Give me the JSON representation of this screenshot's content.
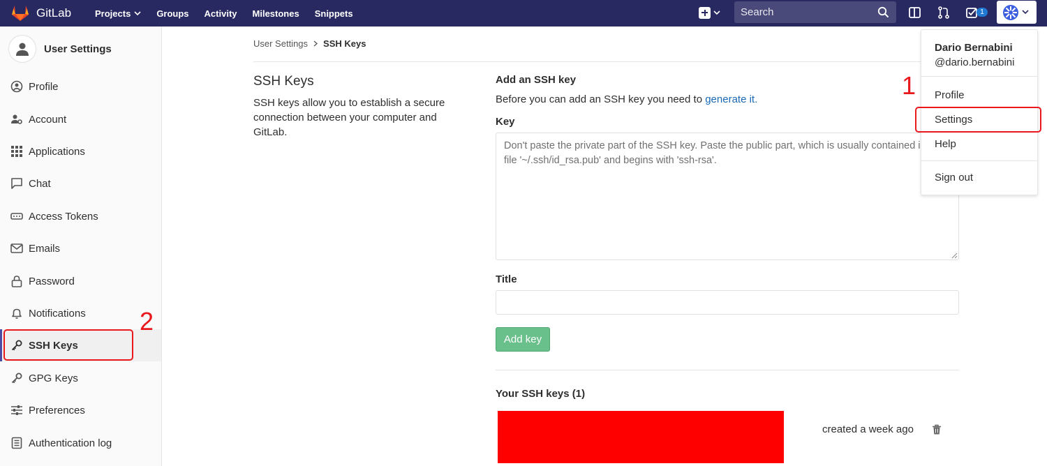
{
  "navbar": {
    "brand": "GitLab",
    "links": [
      "Projects",
      "Groups",
      "Activity",
      "Milestones",
      "Snippets"
    ],
    "search_placeholder": "Search",
    "todo_count": "1",
    "bg_color": "#292961"
  },
  "sidebar": {
    "title": "User Settings",
    "items": [
      {
        "label": "Profile",
        "icon": "profile-icon"
      },
      {
        "label": "Account",
        "icon": "account-icon"
      },
      {
        "label": "Applications",
        "icon": "applications-icon"
      },
      {
        "label": "Chat",
        "icon": "chat-icon"
      },
      {
        "label": "Access Tokens",
        "icon": "token-icon"
      },
      {
        "label": "Emails",
        "icon": "mail-icon"
      },
      {
        "label": "Password",
        "icon": "lock-icon"
      },
      {
        "label": "Notifications",
        "icon": "bell-icon"
      },
      {
        "label": "SSH Keys",
        "icon": "key-icon"
      },
      {
        "label": "GPG Keys",
        "icon": "key-icon"
      },
      {
        "label": "Preferences",
        "icon": "sliders-icon"
      },
      {
        "label": "Authentication log",
        "icon": "log-icon"
      }
    ]
  },
  "breadcrumb": {
    "parent": "User Settings",
    "current": "SSH Keys"
  },
  "main": {
    "section_title": "SSH Keys",
    "section_description": "SSH keys allow you to establish a secure connection between your computer and GitLab.",
    "add_title": "Add an SSH key",
    "add_description_prefix": "Before you can add an SSH key you need to ",
    "add_description_link": "generate it.",
    "key_label": "Key",
    "key_placeholder": "Don't paste the private part of the SSH key. Paste the public part, which is usually contained in the file '~/.ssh/id_rsa.pub' and begins with 'ssh-rsa'.",
    "title_label": "Title",
    "add_button": "Add key",
    "keys_title": "Your SSH keys (1)",
    "keys": [
      {
        "created": "created a week ago"
      }
    ]
  },
  "dropdown": {
    "name": "Dario Bernabini",
    "handle": "@dario.bernabini",
    "items": [
      "Profile",
      "Settings",
      "Help",
      "Sign out"
    ]
  },
  "annotations": {
    "first": "1",
    "second": "2",
    "color": "#e8181d"
  }
}
